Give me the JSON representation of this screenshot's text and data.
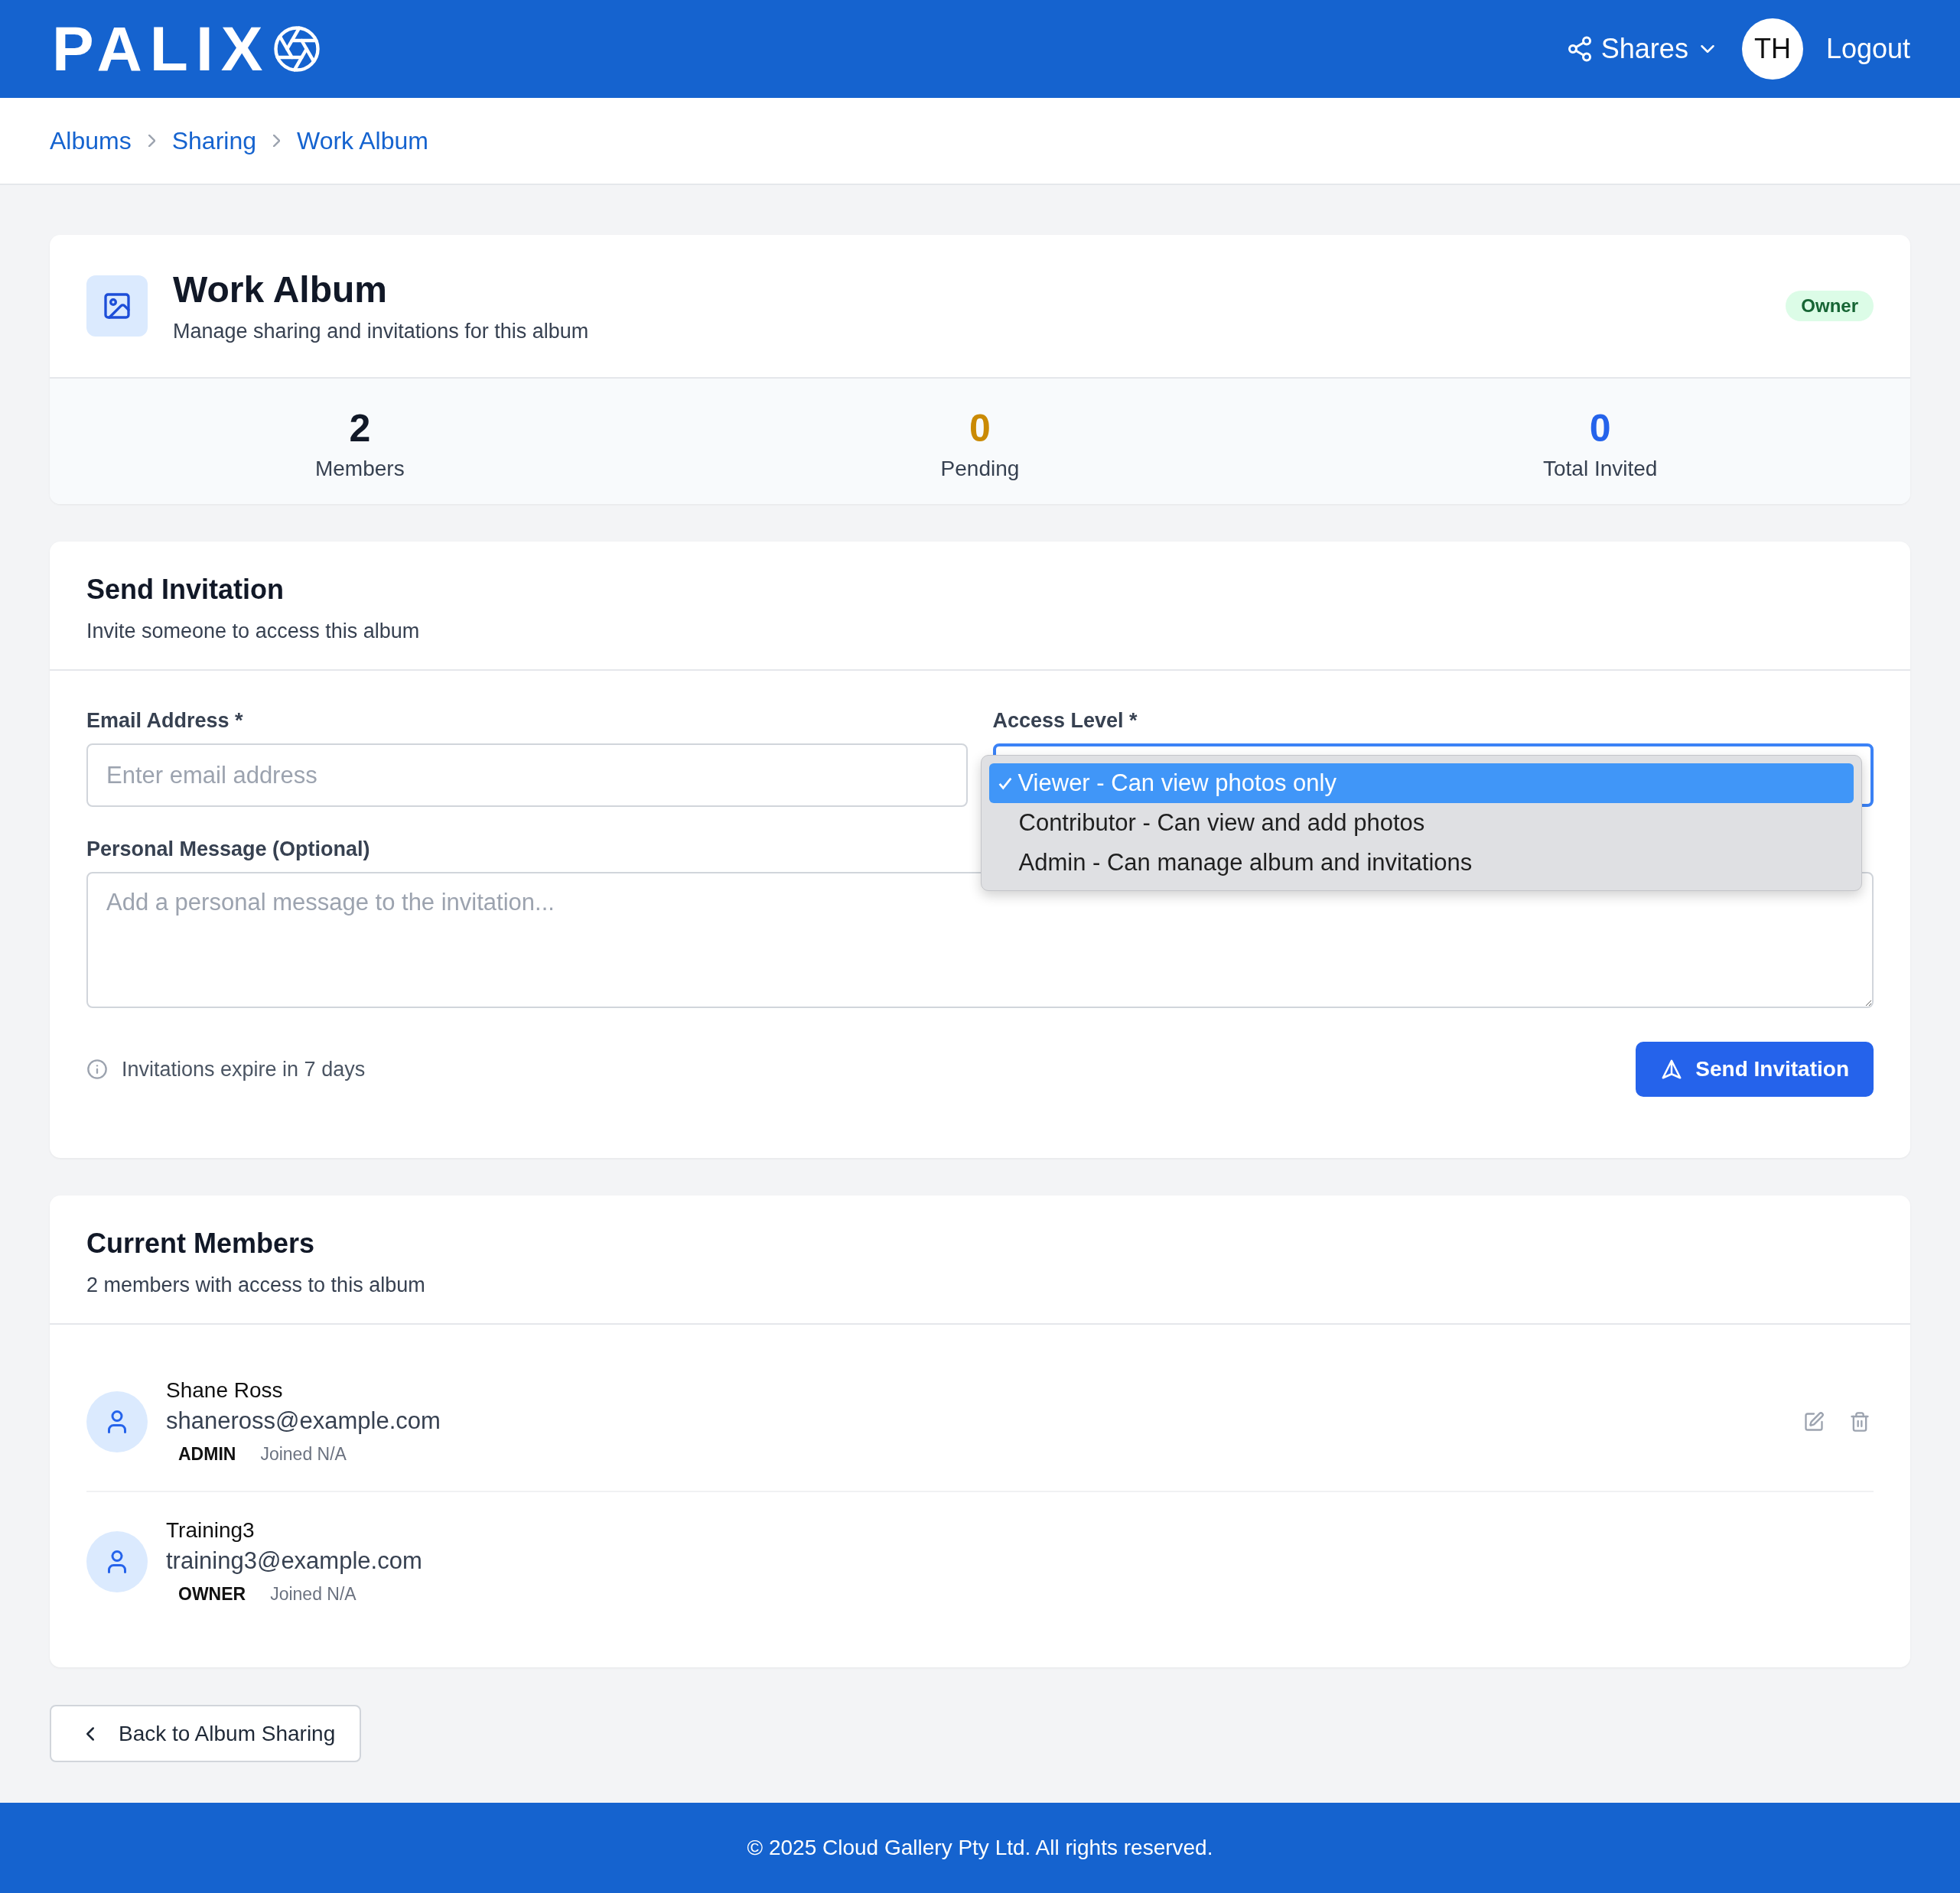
{
  "header": {
    "logo": "PALIX",
    "shares_menu": "Shares",
    "avatar_initials": "TH",
    "logout": "Logout"
  },
  "breadcrumbs": [
    "Albums",
    "Sharing",
    "Work Album"
  ],
  "album": {
    "title": "Work Album",
    "subtitle": "Manage sharing and invitations for this album",
    "role_badge": "Owner"
  },
  "stats": [
    {
      "value": "2",
      "label": "Members",
      "color": "#111827"
    },
    {
      "value": "0",
      "label": "Pending",
      "color": "#ca8a04"
    },
    {
      "value": "0",
      "label": "Total Invited",
      "color": "#2563eb"
    }
  ],
  "invitation": {
    "title": "Send Invitation",
    "subtitle": "Invite someone to access this album",
    "email": {
      "label": "Email Address *",
      "placeholder": "Enter email address"
    },
    "access_level": {
      "label": "Access Level *",
      "expanded": true,
      "options": [
        {
          "label": "Viewer - Can view photos only",
          "selected": true
        },
        {
          "label": "Contributor - Can view and add photos",
          "selected": false
        },
        {
          "label": "Admin - Can manage album and invitations",
          "selected": false
        }
      ]
    },
    "message": {
      "label": "Personal Message (Optional)",
      "placeholder": "Add a personal message to the invitation..."
    },
    "expiry_note": "Invitations expire in 7 days",
    "send_button": "Send Invitation"
  },
  "members": {
    "title": "Current Members",
    "subtitle": "2 members with access to this album",
    "list": [
      {
        "name": "Shane Ross",
        "email": "shaneross@example.com",
        "role": "ADMIN",
        "joined": "Joined N/A",
        "actions": true
      },
      {
        "name": "Training3",
        "email": "training3@example.com",
        "role": "OWNER",
        "joined": "Joined N/A",
        "actions": false
      }
    ]
  },
  "back_button": "Back to Album Sharing",
  "footer": "© 2025 Cloud Gallery Pty Ltd. All rights reserved."
}
